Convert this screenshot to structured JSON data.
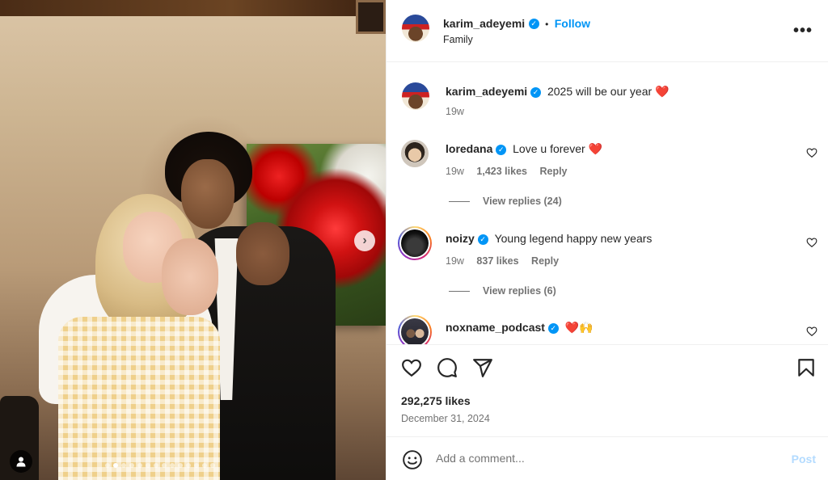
{
  "post": {
    "author": "karim_adeyemi",
    "follow_label": "Follow",
    "separator": "•",
    "subtitle": "Family",
    "more_label": "•••",
    "caption": {
      "user": "karim_adeyemi",
      "text": "2025 will be our year",
      "emoji": "❤️",
      "time": "19w"
    },
    "likes": "292,275 likes",
    "date": "December 31, 2024",
    "carousel": {
      "dot_count": 14,
      "active_index": 1,
      "next_icon": "chevron-right-icon"
    }
  },
  "comments": [
    {
      "user": "loredana",
      "text": "Love u forever",
      "emoji": "❤️",
      "time": "19w",
      "likes": "1,423 likes",
      "reply": "Reply",
      "view_replies": "View replies (24)"
    },
    {
      "user": "noizy",
      "text": "Young legend happy new years",
      "emoji": "",
      "time": "19w",
      "likes": "837 likes",
      "reply": "Reply",
      "view_replies": "View replies (6)"
    },
    {
      "user": "noxname_podcast",
      "text": "",
      "emoji": "❤️🙌",
      "time": "",
      "likes": "",
      "reply": "",
      "view_replies": ""
    }
  ],
  "add_comment": {
    "placeholder": "Add a comment...",
    "post_label": "Post"
  },
  "icons": {
    "like": "heart-icon",
    "comment": "comment-icon",
    "share": "send-icon",
    "save": "bookmark-icon",
    "emoji": "emoji-icon",
    "tag": "user-tag-icon"
  },
  "colors": {
    "accent": "#0095f6",
    "heart": "#ed4956",
    "post_disabled": "#b3dbff"
  }
}
